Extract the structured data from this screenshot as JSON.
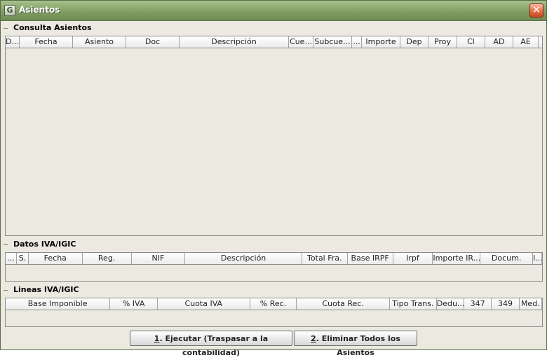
{
  "window": {
    "title": "Asientos",
    "app_icon": "G",
    "close_glyph": "✕"
  },
  "sections": {
    "asientos": {
      "title": "Consulta Asientos",
      "columns": [
        "D...",
        "Fecha",
        "Asiento",
        "Doc",
        "Descripción",
        "Cue...",
        "Subcue...",
        "...",
        "Importe",
        "Dep",
        "Proy",
        "Cl",
        "AD",
        "AE"
      ]
    },
    "datos_iva": {
      "title": "Datos IVA/IGIC",
      "columns": [
        "...",
        "S.",
        "Fecha",
        "Reg.",
        "NIF",
        "Descripción",
        "Total Fra.",
        "Base IRPF",
        "Irpf",
        "Importe IR...",
        "Docum.",
        "I..."
      ]
    },
    "lineas_iva": {
      "title": "Lineas IVA/IGIC",
      "columns": [
        "Base Imponible",
        "% IVA",
        "Cuota IVA",
        "% Rec.",
        "Cuota Rec.",
        "Tipo Trans.",
        "Dedu...",
        "347",
        "349",
        "Med."
      ]
    }
  },
  "buttons": {
    "ejecutar": {
      "mnemonic": "1",
      "rest": ". Ejecutar (Traspasar a la contabilidad)"
    },
    "eliminar": {
      "mnemonic": "2",
      "rest": ". Eliminar Todos los Asientos"
    }
  }
}
